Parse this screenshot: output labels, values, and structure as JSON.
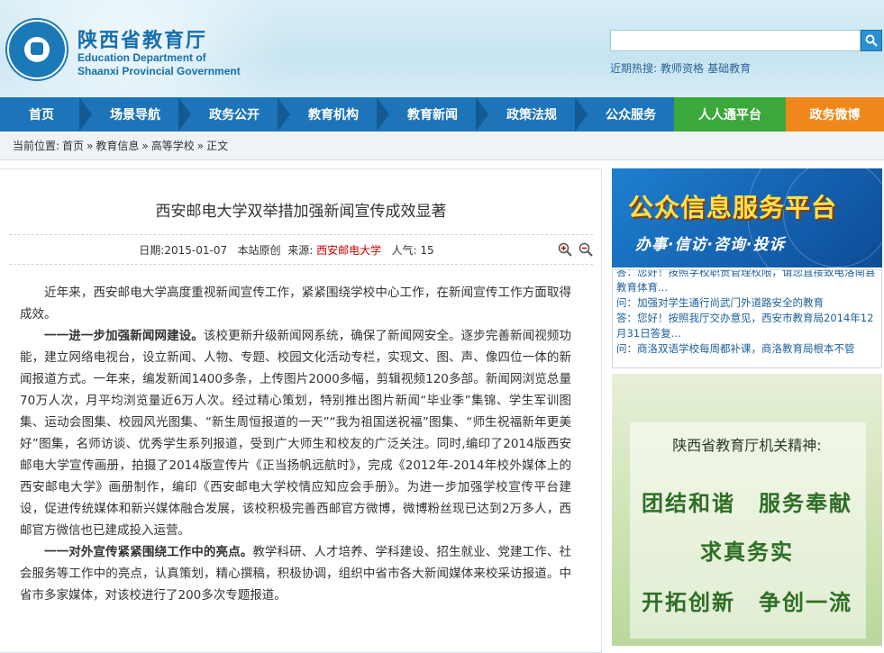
{
  "header": {
    "site_name_cn": "陕西省教育厅",
    "site_name_en_line1": "Education Department of",
    "site_name_en_line2": "Shaanxi Provincial Government",
    "search_placeholder": "",
    "hot_label": "近期热搜:",
    "hot_links": [
      "教师资格",
      "基础教育"
    ]
  },
  "nav": {
    "items": [
      "首页",
      "场景导航",
      "政务公开",
      "教育机构",
      "教育新闻",
      "政策法规",
      "公众服务",
      "人人通平台",
      "政务微博"
    ]
  },
  "breadcrumb": {
    "label": "当前位置:",
    "items": [
      "首页",
      "»",
      "教育信息",
      "»",
      "高等学校",
      "»",
      "正文"
    ]
  },
  "article": {
    "title": "西安邮电大学双举措加强新闻宣传成效显著",
    "date_label": "日期:",
    "date": "2015-01-07",
    "origin": "本站原创",
    "source_label": "来源:",
    "source": "西安邮电大学",
    "views_label": "人气:",
    "views": "15",
    "p1": "近年来，西安邮电大学高度重视新闻宣传工作，紧紧围绕学校中心工作，在新闻宣传工作方面取得成效。",
    "p2_bold": "一一进一步加强新闻网建设。",
    "p2": "该校更新升级新闻网系统，确保了新闻网安全。逐步完善新闻视频功能，建立网络电视台，设立新闻、人物、专题、校园文化活动专栏，实现文、图、声、像四位一体的新闻报道方式。一年来，编发新闻1400多条，上传图片2000多幅，剪辑视频120多部。新闻网浏览总量70万人次，月平均浏览量近6万人次。经过精心策划，特别推出图片新闻“毕业季”集锦、学生军训图集、运动会图集、校园风光图集、“新生周恒报道的一天”“我为祖国送祝福”图集、“师生祝福新年更美好”图集，名师访谈、优秀学生系列报道，受到广大师生和校友的广泛关注。同时,编印了2014版西安邮电大学宣传画册，拍摄了2014版宣传片《正当扬帆远航时》，完成《2012年-2014年校外媒体上的西安邮电大学》画册制作，编印《西安邮电大学校情应知应会手册》。为进一步加强学校宣传平台建设，促进传统媒体和新兴媒体融合发展，该校积极完善西邮官方微博，微博粉丝现已达到2万多人，西邮官方微信也已建成投入运营。",
    "p3_bold": "一一对外宣传紧紧围绕工作中的亮点。",
    "p3": "教学科研、人才培养、学科建设、招生就业、党建工作、社会服务等工作中的亮点，认真策划，精心撰稿，积极协调，组织中省市各大新闻媒体来校采访报道。中省市多家媒体，对该校进行了200多次专题报道。"
  },
  "sidebar": {
    "banner1_title": "公众信息服务平台",
    "banner1_sub": "办事·信访·咨询·投诉",
    "qa": [
      "答：您好！按照学校职责管理权限，请您直接致电洛南县教育体育...",
      "问：加强对学生通行尚武门外道路安全的教育",
      "答：您好！按照我厅交办意见，西安市教育局2014年12月31日答复...",
      "问：商洛双语学校每周都补课，商洛教育局根本不管"
    ],
    "banner2_title": "陕西省教育厅机关精神:",
    "banner2_line1": "团结和谐　服务奉献",
    "banner2_line2": "求真务实",
    "banner2_line3": "开拓创新　争创一流"
  }
}
